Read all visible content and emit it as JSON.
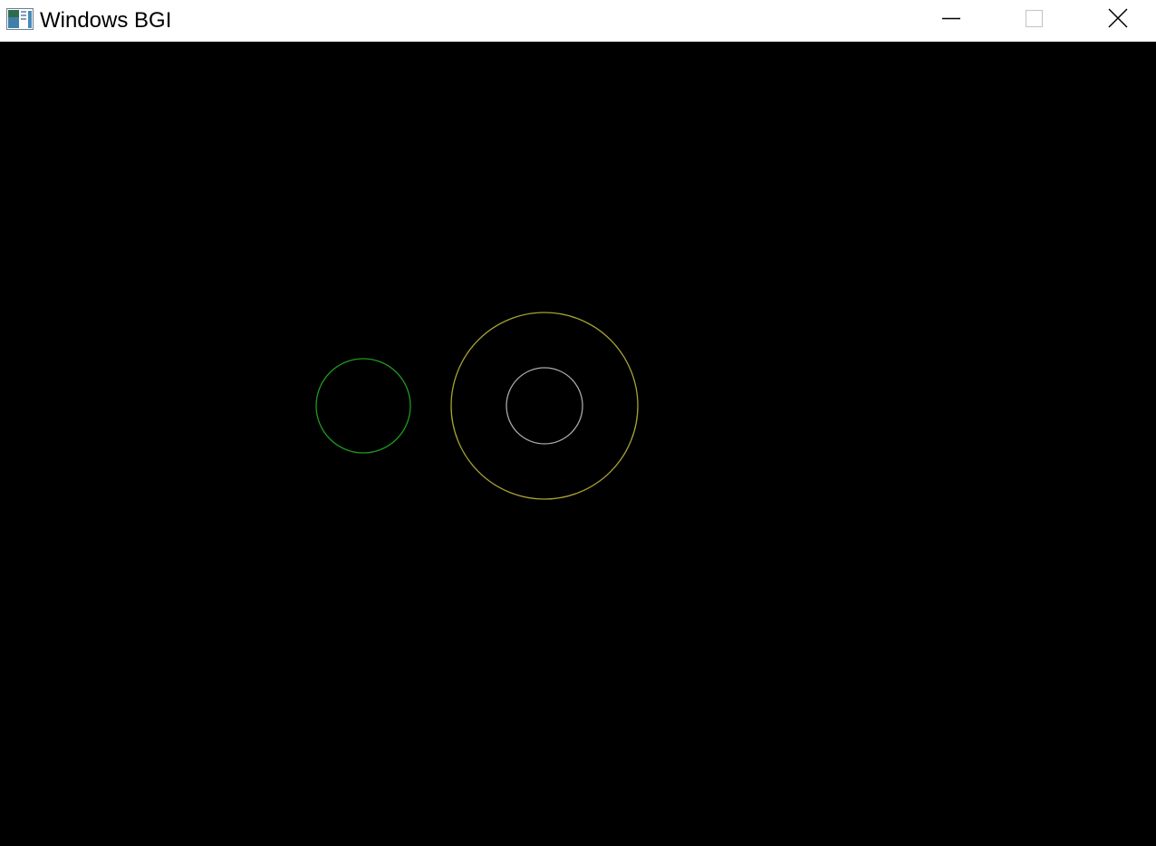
{
  "window": {
    "title": "Windows BGI",
    "icon": "bgi-app-icon",
    "controls": [
      {
        "name": "minimize",
        "icon": "minimize-icon"
      },
      {
        "name": "maximize",
        "icon": "maximize-icon"
      },
      {
        "name": "close",
        "icon": "close-icon"
      }
    ]
  },
  "colors": {
    "background": "#000000",
    "titlebar": "#ffffff",
    "green_circle": "#1e9a1e",
    "yellow_circle": "#a8a232",
    "gray_circle": "#a8a8a8"
  }
}
